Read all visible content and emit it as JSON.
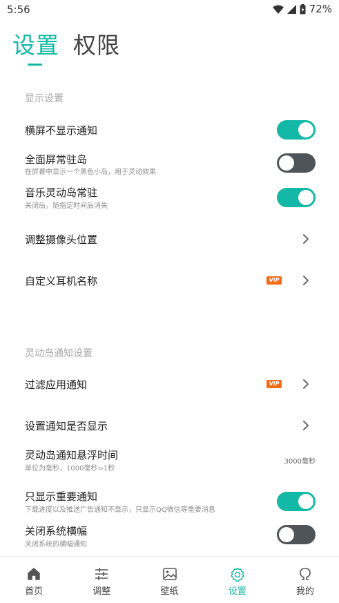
{
  "status_bar": {
    "time": "5:56",
    "battery": "72%"
  },
  "header": {
    "tabs": [
      {
        "label": "设置",
        "active": true
      },
      {
        "label": "权限",
        "active": false
      }
    ]
  },
  "display_section": {
    "title": "显示设置",
    "rows": [
      {
        "title": "横屏不显示通知",
        "subtitle": "",
        "toggle": true
      },
      {
        "title": "全面屏常驻岛",
        "subtitle": "在屏幕中显示一个黑色小岛，用于灵动效果",
        "toggle": false
      },
      {
        "title": "音乐灵动岛常驻",
        "subtitle": "关闭后，随指定时间后消失",
        "toggle": true
      },
      {
        "title": "调整摄像头位置"
      },
      {
        "title": "自定义耳机名称",
        "vip": "VIP"
      }
    ]
  },
  "notify_section": {
    "title": "灵动岛通知设置",
    "rows": [
      {
        "title": "过滤应用通知",
        "vip": "VIP"
      },
      {
        "title": "设置通知是否显示"
      },
      {
        "title": "灵动岛通知悬浮时间",
        "subtitle": "单位为毫秒，1000毫秒=1秒",
        "value": "3000毫秒"
      },
      {
        "title": "只显示重要通知",
        "subtitle": "下载进度以及推送广告通知不显示，只显示QQ微信等重要消息",
        "toggle": true
      },
      {
        "title": "关闭系统横幅",
        "subtitle": "关闭系统的横幅通知",
        "toggle": false
      }
    ]
  },
  "bottom_nav": {
    "items": [
      {
        "label": "首页",
        "icon": "home-icon",
        "active": false
      },
      {
        "label": "调整",
        "icon": "sliders-icon",
        "active": false
      },
      {
        "label": "壁纸",
        "icon": "image-icon",
        "active": false
      },
      {
        "label": "设置",
        "icon": "gear-icon",
        "active": true
      },
      {
        "label": "我的",
        "icon": "user-icon",
        "active": false
      }
    ]
  },
  "colors": {
    "accent": "#13b8a6",
    "toggle_off": "#4f5458",
    "vip": "#f36a14"
  }
}
